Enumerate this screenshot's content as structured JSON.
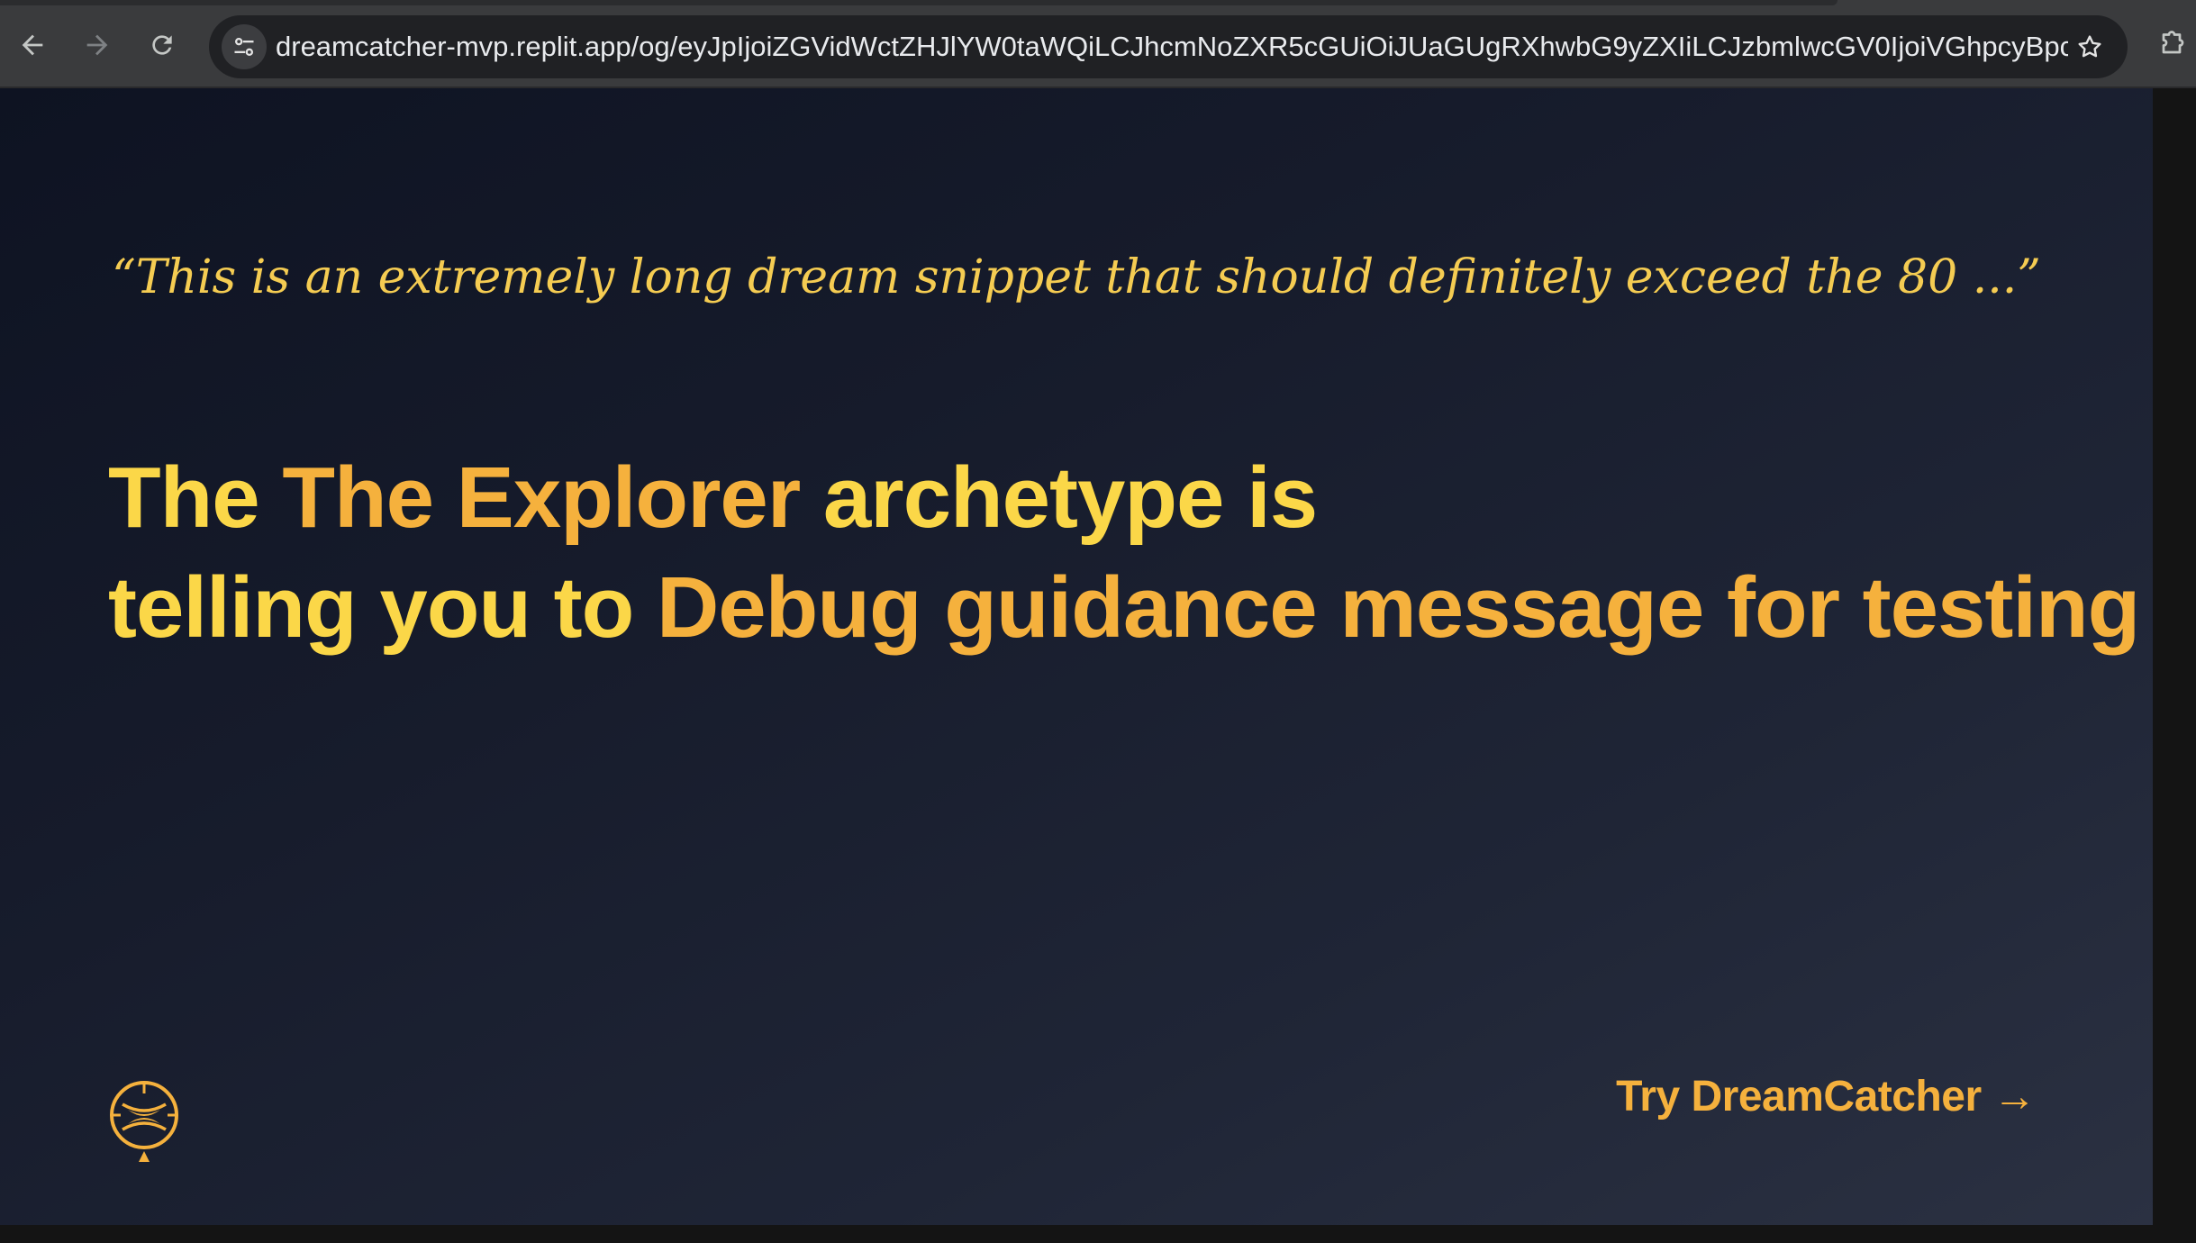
{
  "browser": {
    "url": "dreamcatcher-mvp.replit.app/og/eyJpIjoiZGVidWctZHJlYW0taWQiLCJhcmNoZXR5cGUiOiJUaGUgRXhwbG9yZXIiLCJzbmlwcGV0IjoiVGhpcyBpcyBh...",
    "icons": {
      "back": "arrow-left-icon",
      "forward": "arrow-right-icon",
      "reload": "reload-icon",
      "site_info": "tune-icon",
      "bookmark": "star-icon",
      "extensions": "puzzle-icon"
    }
  },
  "page": {
    "quote": "“This is an extremely long dream snippet that should definitely exceed the 80 ...”",
    "headline": {
      "prefix": "The ",
      "archetype": "The Explorer",
      "mid1": " archetype is",
      "mid2": "telling you to ",
      "guidance": "Debug guidance message for testing .",
      "suffix": ""
    },
    "logo_icon": "dreamcatcher-logo-icon",
    "cta": "Try DreamCatcher →"
  },
  "colors": {
    "quote": "#f5cc52",
    "headline_primary": "#fbd748",
    "headline_accent": "#f5b13d",
    "background_start": "#0e1322",
    "background_end": "#2b3142"
  }
}
